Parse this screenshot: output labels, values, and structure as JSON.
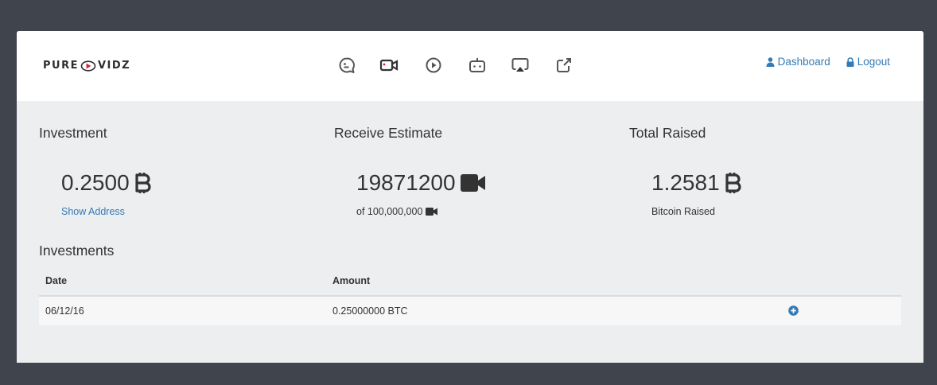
{
  "brand": {
    "logo_left": "PURE",
    "logo_right": "VIDZ",
    "icons": [
      "chat-icon",
      "video-camera-icon",
      "play-circle-icon",
      "robot-icon",
      "airplay-icon",
      "share-icon"
    ]
  },
  "top_nav": {
    "dashboard": "Dashboard",
    "logout": "Logout"
  },
  "stats": {
    "investment": {
      "heading": "Investment",
      "value": "0.2500",
      "link": "Show Address"
    },
    "receive": {
      "heading": "Receive Estimate",
      "value": "19871200",
      "sub": "of 100,000,000"
    },
    "raised": {
      "heading": "Total Raised",
      "value": "1.2581",
      "sub": "Bitcoin Raised"
    }
  },
  "investments": {
    "title": "Investments",
    "columns": [
      "Date",
      "Amount"
    ],
    "rows": [
      {
        "date": "06/12/16",
        "amount": "0.25000000 BTC"
      }
    ]
  },
  "colors": {
    "page_bg": "#3f444d",
    "card_bg": "#edeef0",
    "link": "#337ab7",
    "brand_red": "#d0233a"
  }
}
